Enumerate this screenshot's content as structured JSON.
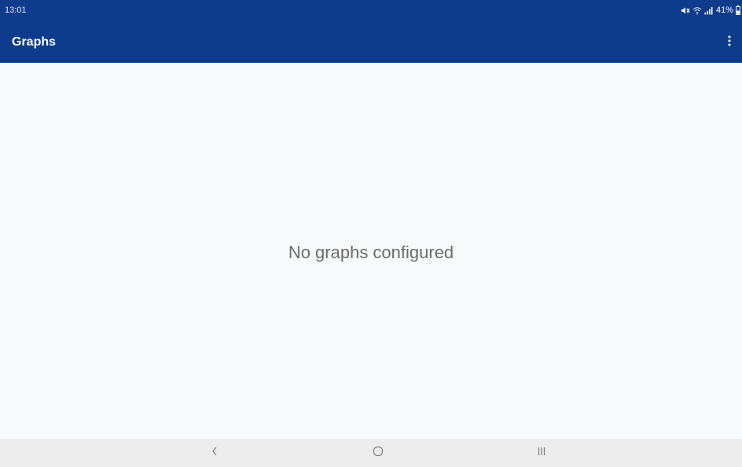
{
  "status_bar": {
    "time": "13:01",
    "battery": "41%",
    "icons": [
      "mute-icon",
      "wifi-icon",
      "signal-icon",
      "battery-icon"
    ]
  },
  "app_bar": {
    "title": "Graphs",
    "menu_icon": "more-vert-icon"
  },
  "main": {
    "empty_message": "No graphs configured"
  },
  "nav_bar": {
    "buttons": [
      "back-icon",
      "home-icon",
      "recents-icon"
    ]
  },
  "colors": {
    "primary": "#0e3c8c",
    "background": "#f8f9fa",
    "empty_text": "#6b6b6b",
    "nav_bar": "#ececec"
  }
}
